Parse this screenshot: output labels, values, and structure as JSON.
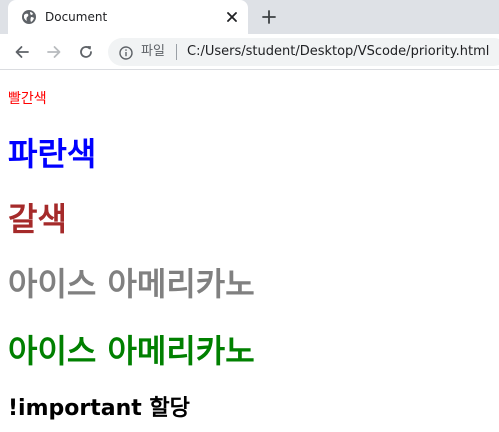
{
  "browser": {
    "tab": {
      "title": "Document"
    },
    "address_bar": {
      "scheme_label": "파일",
      "url": "C:/Users/student/Desktop/VScode/priority.html"
    }
  },
  "page": {
    "lines": [
      {
        "text": "빨간색",
        "color": "#ff0000"
      },
      {
        "text": "파란색",
        "color": "#0000ff"
      },
      {
        "text": "갈색",
        "color": "#a52a2a"
      },
      {
        "text": "아이스 아메리카노",
        "color": "#808080"
      },
      {
        "text": "아이스 아메리카노",
        "color": "#008000"
      },
      {
        "text": "!important 할당",
        "color": "#000000"
      }
    ]
  },
  "icons": {
    "favicon": "globe-icon",
    "tab_close": "close-icon",
    "new_tab": "plus-icon",
    "back": "arrow-left-icon",
    "forward": "arrow-right-icon",
    "reload": "reload-icon",
    "site_info": "info-icon"
  }
}
